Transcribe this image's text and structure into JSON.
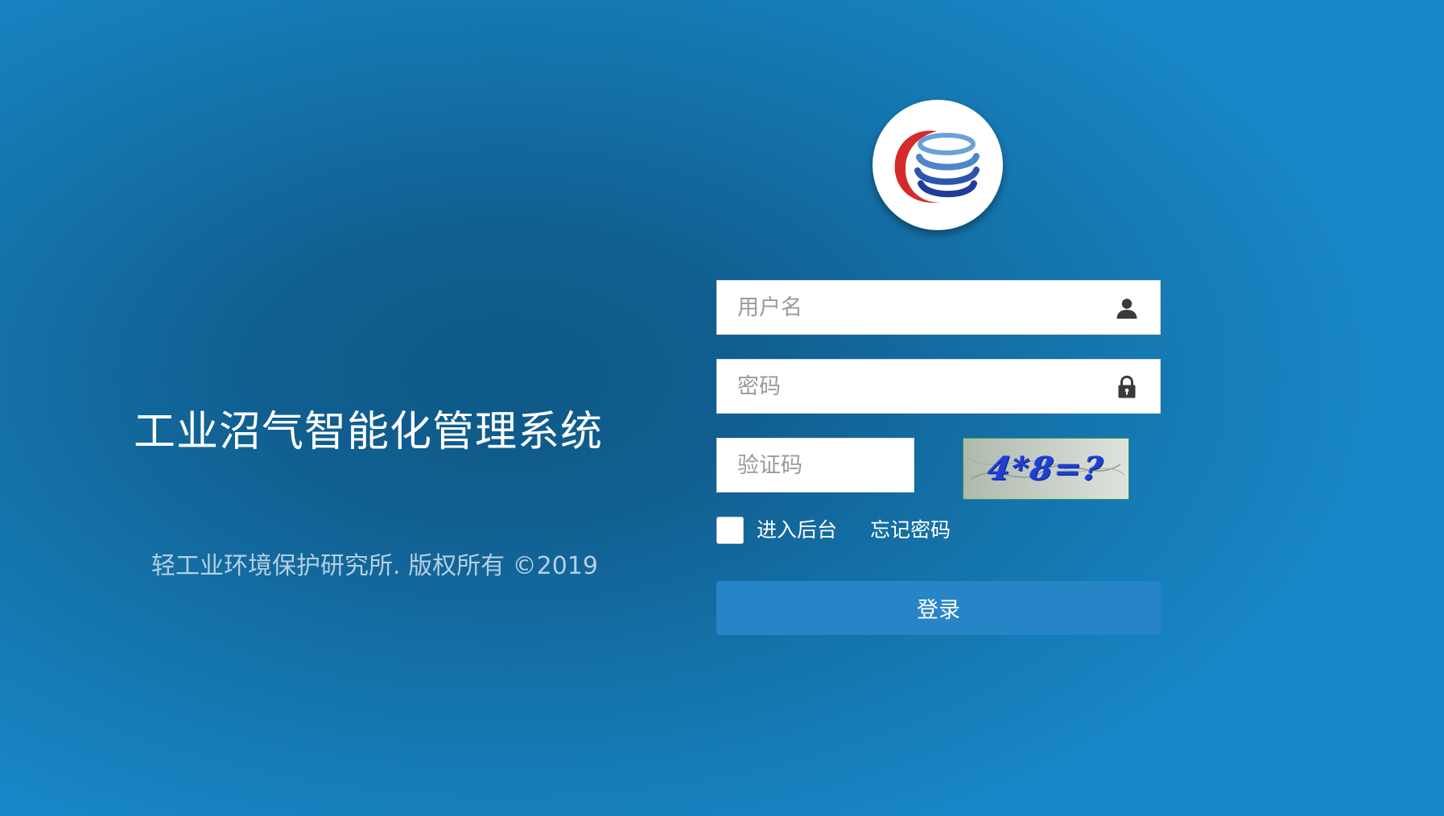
{
  "branding": {
    "app_title": "工业沼气智能化管理系统",
    "copyright": "轻工业环境保护研究所. 版权所有 ©2019",
    "logo_icon": "database-swirl-logo-icon",
    "logo_colors": {
      "red": "#d62a2a",
      "dark_blue": "#1f3c9a",
      "light_blue": "#6aa1d8"
    }
  },
  "login_form": {
    "username": {
      "placeholder": "用户名",
      "value": "",
      "icon": "user-icon"
    },
    "password": {
      "placeholder": "密码",
      "value": "",
      "icon": "lock-icon"
    },
    "captcha": {
      "placeholder": "验证码",
      "value": "",
      "image_text": "4*8=?"
    },
    "admin_checkbox": {
      "label": "进入后台",
      "checked": false
    },
    "forgot_password_label": "忘记密码",
    "submit_label": "登录"
  },
  "colors": {
    "background_dark": "#0d5987",
    "background_light": "#1887c8",
    "button": "#2784c6",
    "copyright_text": "#b5cfe2"
  }
}
